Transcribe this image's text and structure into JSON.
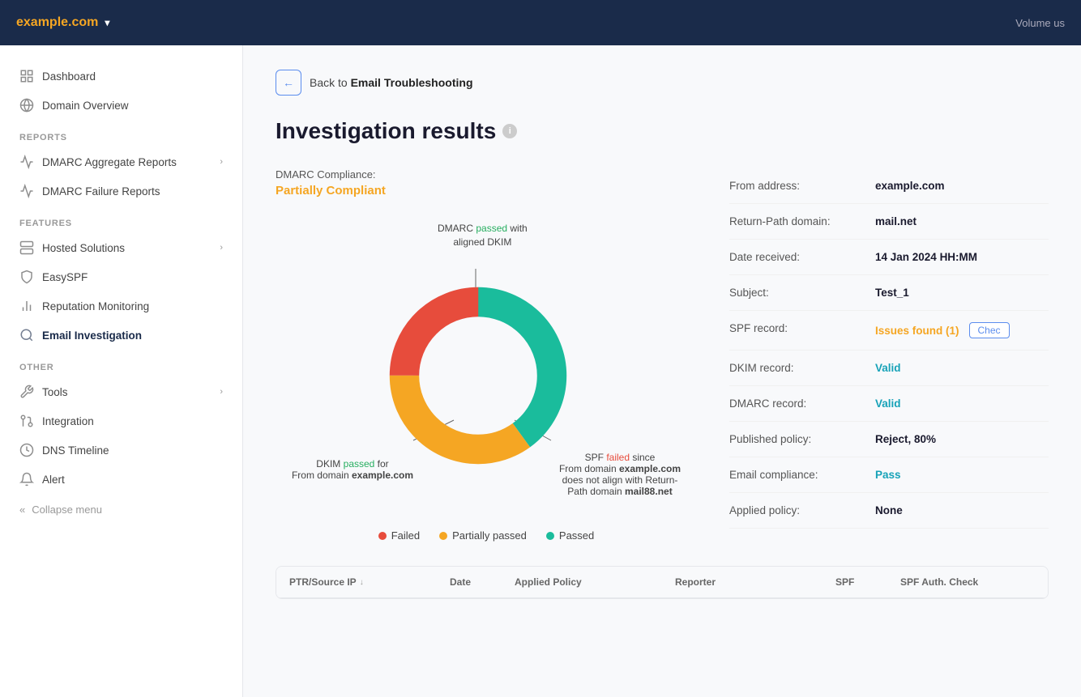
{
  "topbar": {
    "domain": "example.com",
    "chevron": "▾",
    "volume_label": "Volume us"
  },
  "sidebar": {
    "nav_items": [
      {
        "id": "dashboard",
        "label": "Dashboard",
        "icon": "grid",
        "has_chevron": false
      },
      {
        "id": "domain-overview",
        "label": "Domain Overview",
        "icon": "globe",
        "has_chevron": false
      }
    ],
    "sections": [
      {
        "label": "REPORTS",
        "items": [
          {
            "id": "dmarc-aggregate",
            "label": "DMARC Aggregate Reports",
            "icon": "chart",
            "has_chevron": true
          },
          {
            "id": "dmarc-failure",
            "label": "DMARC Failure Reports",
            "icon": "chart-fail",
            "has_chevron": false
          }
        ]
      },
      {
        "label": "FEATURES",
        "items": [
          {
            "id": "hosted-solutions",
            "label": "Hosted Solutions",
            "icon": "server",
            "has_chevron": true
          },
          {
            "id": "easyspf",
            "label": "EasySPF",
            "icon": "spf",
            "has_chevron": false
          },
          {
            "id": "reputation",
            "label": "Reputation Monitoring",
            "icon": "reputation",
            "has_chevron": false
          },
          {
            "id": "email-investigation",
            "label": "Email Investigation",
            "icon": "email",
            "has_chevron": false,
            "active": true
          }
        ]
      },
      {
        "label": "OTHER",
        "items": [
          {
            "id": "tools",
            "label": "Tools",
            "icon": "tools",
            "has_chevron": true
          },
          {
            "id": "integration",
            "label": "Integration",
            "icon": "integration",
            "has_chevron": false
          },
          {
            "id": "dns-timeline",
            "label": "DNS Timeline",
            "icon": "dns",
            "has_chevron": false
          },
          {
            "id": "alert",
            "label": "Alert",
            "icon": "alert",
            "has_chevron": false
          }
        ]
      }
    ],
    "collapse_label": "Collapse menu"
  },
  "back": {
    "label": "Back to ",
    "destination": "Email Troubleshooting",
    "arrow": "←"
  },
  "page": {
    "title": "Investigation results"
  },
  "dmarc": {
    "compliance_label": "DMARC Compliance:",
    "compliance_status": "Partially Compliant"
  },
  "chart": {
    "annotations": {
      "top": "DMARC passed with aligned DKIM",
      "top_highlight": "passed",
      "bottom_left_line1": "DKIM passed for",
      "bottom_left_line2": "From domain example.com",
      "bottom_left_highlight": "passed",
      "bottom_right_line1": "SPF failed since",
      "bottom_right_line2": "From domain example.com",
      "bottom_right_line3": "does not align with Return-Path domain mail88.net",
      "bottom_right_highlight": "failed"
    },
    "segments": [
      {
        "label": "Passed",
        "color": "#1abc9c",
        "percent": 40
      },
      {
        "label": "Partially passed",
        "color": "#f5a623",
        "percent": 35
      },
      {
        "label": "Failed",
        "color": "#e74c3c",
        "percent": 25
      }
    ],
    "legend": [
      {
        "label": "Failed",
        "color": "#e74c3c"
      },
      {
        "label": "Partially passed",
        "color": "#f5a623"
      },
      {
        "label": "Passed",
        "color": "#1abc9c"
      }
    ]
  },
  "info_panel": {
    "rows": [
      {
        "id": "from-address",
        "label": "From address:",
        "value": "example.com",
        "style": "normal"
      },
      {
        "id": "return-path",
        "label": "Return-Path domain:",
        "value": "mail.net",
        "style": "normal"
      },
      {
        "id": "date-received",
        "label": "Date received:",
        "value": "14 Jan 2024 HH:MM",
        "style": "normal"
      },
      {
        "id": "subject",
        "label": "Subject:",
        "value": "Test_1",
        "style": "normal"
      },
      {
        "id": "spf-record",
        "label": "SPF record:",
        "value": "Issues found (1)",
        "style": "orange",
        "has_check": true,
        "check_label": "Chec"
      },
      {
        "id": "dkim-record",
        "label": "DKIM record:",
        "value": "Valid",
        "style": "cyan"
      },
      {
        "id": "dmarc-record",
        "label": "DMARC record:",
        "value": "Valid",
        "style": "cyan"
      },
      {
        "id": "published-policy",
        "label": "Published policy:",
        "value": "Reject, 80%",
        "style": "normal"
      },
      {
        "id": "email-compliance",
        "label": "Email compliance:",
        "value": "Pass",
        "style": "cyan"
      },
      {
        "id": "applied-policy",
        "label": "Applied policy:",
        "value": "None",
        "style": "normal"
      }
    ]
  },
  "table": {
    "columns": [
      {
        "id": "ptr-source",
        "label": "PTR/Source IP",
        "sortable": true
      },
      {
        "id": "date",
        "label": "Date",
        "sortable": false
      },
      {
        "id": "applied-policy",
        "label": "Applied Policy",
        "sortable": false
      },
      {
        "id": "reporter",
        "label": "Reporter",
        "sortable": false
      },
      {
        "id": "spf",
        "label": "SPF",
        "sortable": false
      },
      {
        "id": "spf-auth",
        "label": "SPF Auth. Check",
        "sortable": false
      }
    ]
  }
}
